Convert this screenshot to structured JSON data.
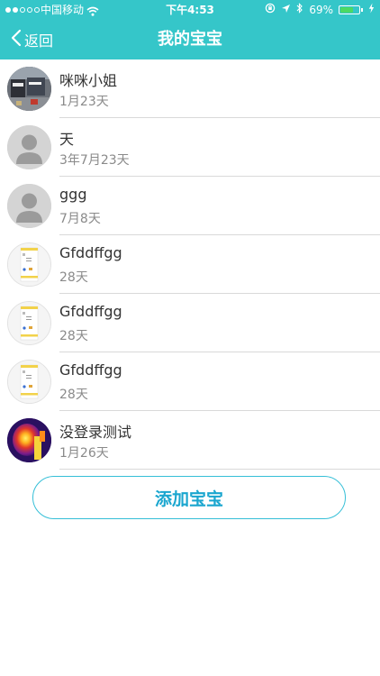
{
  "status_bar": {
    "carrier": "中国移动",
    "time": "下午4:53",
    "battery_percent": "69%",
    "battery_level": 0.69,
    "signal_strength": 2
  },
  "nav": {
    "back_label": "返回",
    "title": "我的宝宝"
  },
  "babies": [
    {
      "name": "咪咪小姐",
      "age": "1月23天",
      "avatar": "photo"
    },
    {
      "name": "天",
      "age": "3年7月23天",
      "avatar": "default"
    },
    {
      "name": "ggg",
      "age": "7月8天",
      "avatar": "default"
    },
    {
      "name": "Gfddffgg",
      "age": "28天",
      "avatar": "screenshot"
    },
    {
      "name": "Gfddffgg",
      "age": "28天",
      "avatar": "screenshot"
    },
    {
      "name": "Gfddffgg",
      "age": "28天",
      "avatar": "screenshot"
    },
    {
      "name": "没登录测试",
      "age": "1月26天",
      "avatar": "thermal"
    }
  ],
  "add_button_label": "添加宝宝",
  "colors": {
    "header": "#35c6c9",
    "accent": "#1aa6cf",
    "divider": "#d9d9d9"
  }
}
